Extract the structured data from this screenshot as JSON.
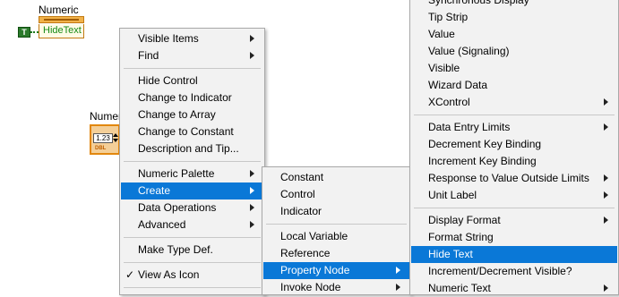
{
  "diagram": {
    "property_node": {
      "title": "Numeric",
      "property": "HideText",
      "constant": "T"
    },
    "control": {
      "title": "Numeric",
      "display": "1.23",
      "type_badge": "DBL"
    }
  },
  "menu_main": {
    "items": [
      {
        "label": "Visible Items",
        "submenu": true
      },
      {
        "label": "Find",
        "submenu": true
      },
      {
        "label": "Hide Control"
      },
      {
        "label": "Change to Indicator"
      },
      {
        "label": "Change to Array"
      },
      {
        "label": "Change to Constant"
      },
      {
        "label": "Description and Tip..."
      },
      {
        "label": "Numeric Palette",
        "submenu": true
      },
      {
        "label": "Create",
        "submenu": true,
        "highlighted": true
      },
      {
        "label": "Data Operations",
        "submenu": true
      },
      {
        "label": "Advanced",
        "submenu": true
      },
      {
        "label": "Make Type Def."
      },
      {
        "label": "View As Icon",
        "checked": true
      }
    ]
  },
  "menu_create": {
    "items": [
      {
        "label": "Constant"
      },
      {
        "label": "Control"
      },
      {
        "label": "Indicator"
      },
      {
        "label": "Local Variable"
      },
      {
        "label": "Reference"
      },
      {
        "label": "Property Node",
        "submenu": true,
        "highlighted": true
      },
      {
        "label": "Invoke Node",
        "submenu": true
      }
    ]
  },
  "menu_property": {
    "items": [
      {
        "label": "Synchronous Display"
      },
      {
        "label": "Tip Strip"
      },
      {
        "label": "Value"
      },
      {
        "label": "Value (Signaling)"
      },
      {
        "label": "Visible"
      },
      {
        "label": "Wizard Data"
      },
      {
        "label": "XControl",
        "submenu": true
      },
      {
        "label": "Data Entry Limits",
        "submenu": true
      },
      {
        "label": "Decrement Key Binding"
      },
      {
        "label": "Increment Key Binding"
      },
      {
        "label": "Response to Value Outside Limits",
        "submenu": true
      },
      {
        "label": "Unit Label",
        "submenu": true
      },
      {
        "label": "Display Format",
        "submenu": true
      },
      {
        "label": "Format String"
      },
      {
        "label": "Hide Text",
        "highlighted": true
      },
      {
        "label": "Increment/Decrement Visible?"
      },
      {
        "label": "Numeric Text",
        "submenu": true
      }
    ]
  },
  "colors": {
    "highlight": "#0a78d7",
    "wire_boolean": "#1c7a1c",
    "numeric_orange": "#e2870e"
  }
}
